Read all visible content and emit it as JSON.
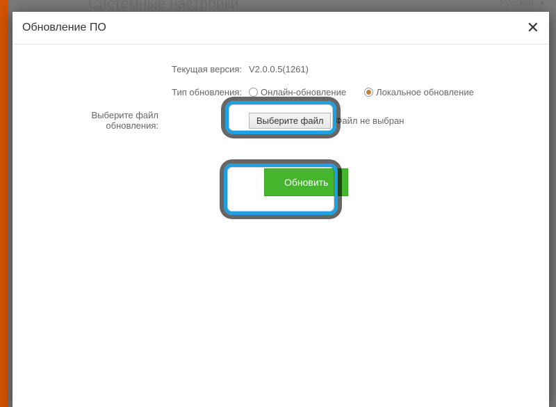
{
  "backdrop": {
    "page_title": "Системные настройки",
    "language": "Русский"
  },
  "modal": {
    "title": "Обновление ПО",
    "current_version_label": "Текущая версия:",
    "current_version_value": "V2.0.0.5(1261)",
    "update_type_label": "Тип обновления:",
    "radio_online": "Онлайн-обновление",
    "radio_local": "Локальное обновление",
    "select_file_label": "Выберите файл обновления:",
    "choose_file_button": "Выберите файл",
    "no_file_text": "Файл не выбран",
    "update_button": "Обновить"
  },
  "colors": {
    "accent_orange": "#d35400",
    "primary_green": "#45b52e",
    "highlight_blue": "#1ea0e0"
  }
}
